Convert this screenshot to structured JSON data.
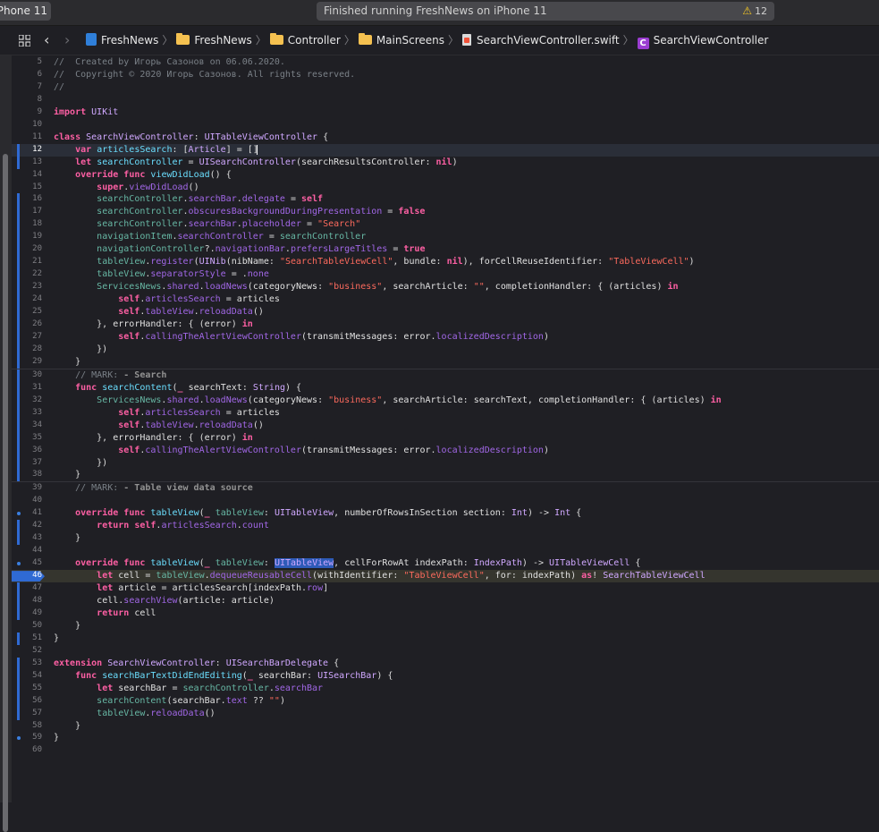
{
  "toolbar": {
    "scheme": "Phone 11",
    "status": "Finished running FreshNews on iPhone 11",
    "warning_count": "12"
  },
  "jumpbar": {
    "items": [
      "FreshNews",
      "FreshNews",
      "Controller",
      "MainScreens",
      "SearchViewController.swift",
      "SearchViewController"
    ]
  },
  "colors": {
    "accent": "#2f6ad3",
    "keyword": "#fc5fa3",
    "string": "#fc6a5d",
    "type": "#d0a8ff"
  },
  "editor": {
    "current_line": "46",
    "lines": [
      {
        "n": "5",
        "t": "//  Created by Игорь Сазонов on 06.06.2020."
      },
      {
        "n": "6",
        "t": "//  Copyright © 2020 Игорь Сазонов. All rights reserved."
      },
      {
        "n": "7",
        "t": "//"
      },
      {
        "n": "8",
        "t": ""
      },
      {
        "n": "9",
        "t": "import UIKit"
      },
      {
        "n": "10",
        "t": ""
      },
      {
        "n": "11",
        "t": "class SearchViewController: UITableViewController {"
      },
      {
        "n": "12",
        "t": "    var articlesSearch: [Article] = []"
      },
      {
        "n": "13",
        "t": "    let searchController = UISearchController(searchResultsController: nil)"
      },
      {
        "n": "14",
        "t": "    override func viewDidLoad() {"
      },
      {
        "n": "15",
        "t": "        super.viewDidLoad()"
      },
      {
        "n": "16",
        "t": "        searchController.searchBar.delegate = self"
      },
      {
        "n": "17",
        "t": "        searchController.obscuresBackgroundDuringPresentation = false"
      },
      {
        "n": "18",
        "t": "        searchController.searchBar.placeholder = \"Search\""
      },
      {
        "n": "19",
        "t": "        navigationItem.searchController = searchController"
      },
      {
        "n": "20",
        "t": "        navigationController?.navigationBar.prefersLargeTitles = true"
      },
      {
        "n": "21",
        "t": "        tableView.register(UINib(nibName: \"SearchTableViewCell\", bundle: nil), forCellReuseIdentifier: \"TableViewCell\")"
      },
      {
        "n": "22",
        "t": "        tableView.separatorStyle = .none"
      },
      {
        "n": "23",
        "t": "        ServicesNews.shared.loadNews(categoryNews: \"business\", searchArticle: \"\", completionHandler: { (articles) in"
      },
      {
        "n": "24",
        "t": "            self.articlesSearch = articles"
      },
      {
        "n": "25",
        "t": "            self.tableView.reloadData()"
      },
      {
        "n": "26",
        "t": "        }, errorHandler: { (error) in"
      },
      {
        "n": "27",
        "t": "            self.callingTheAlertViewController(transmitMessages: error.localizedDescription)"
      },
      {
        "n": "28",
        "t": "        })"
      },
      {
        "n": "29",
        "t": "    }"
      },
      {
        "n": "30",
        "t": "    // MARK: - Search"
      },
      {
        "n": "31",
        "t": "    func searchContent(_ searchText: String) {"
      },
      {
        "n": "32",
        "t": "        ServicesNews.shared.loadNews(categoryNews: \"business\", searchArticle: searchText, completionHandler: { (articles) in"
      },
      {
        "n": "33",
        "t": "            self.articlesSearch = articles"
      },
      {
        "n": "34",
        "t": "            self.tableView.reloadData()"
      },
      {
        "n": "35",
        "t": "        }, errorHandler: { (error) in"
      },
      {
        "n": "36",
        "t": "            self.callingTheAlertViewController(transmitMessages: error.localizedDescription)"
      },
      {
        "n": "37",
        "t": "        })"
      },
      {
        "n": "38",
        "t": "    }"
      },
      {
        "n": "39",
        "t": "    // MARK: - Table view data source"
      },
      {
        "n": "40",
        "t": ""
      },
      {
        "n": "41",
        "t": "    override func tableView(_ tableView: UITableView, numberOfRowsInSection section: Int) -> Int {"
      },
      {
        "n": "42",
        "t": "        return self.articlesSearch.count"
      },
      {
        "n": "43",
        "t": "    }"
      },
      {
        "n": "44",
        "t": ""
      },
      {
        "n": "45",
        "t": "    override func tableView(_ tableView: UITableView, cellForRowAt indexPath: IndexPath) -> UITableViewCell {"
      },
      {
        "n": "46",
        "t": "        let cell = tableView.dequeueReusableCell(withIdentifier: \"TableViewCell\", for: indexPath) as! SearchTableViewCell"
      },
      {
        "n": "47",
        "t": "        let article = articlesSearch[indexPath.row]"
      },
      {
        "n": "48",
        "t": "        cell.searchView(article: article)"
      },
      {
        "n": "49",
        "t": "        return cell"
      },
      {
        "n": "50",
        "t": "    }"
      },
      {
        "n": "51",
        "t": "}"
      },
      {
        "n": "52",
        "t": ""
      },
      {
        "n": "53",
        "t": "extension SearchViewController: UISearchBarDelegate {"
      },
      {
        "n": "54",
        "t": "    func searchBarTextDidEndEditing(_ searchBar: UISearchBar) {"
      },
      {
        "n": "55",
        "t": "        let searchBar = searchController.searchBar"
      },
      {
        "n": "56",
        "t": "        searchContent(searchBar.text ?? \"\")"
      },
      {
        "n": "57",
        "t": "        tableView.reloadData()"
      },
      {
        "n": "58",
        "t": "    }"
      },
      {
        "n": "59",
        "t": "}"
      },
      {
        "n": "60",
        "t": ""
      }
    ]
  }
}
